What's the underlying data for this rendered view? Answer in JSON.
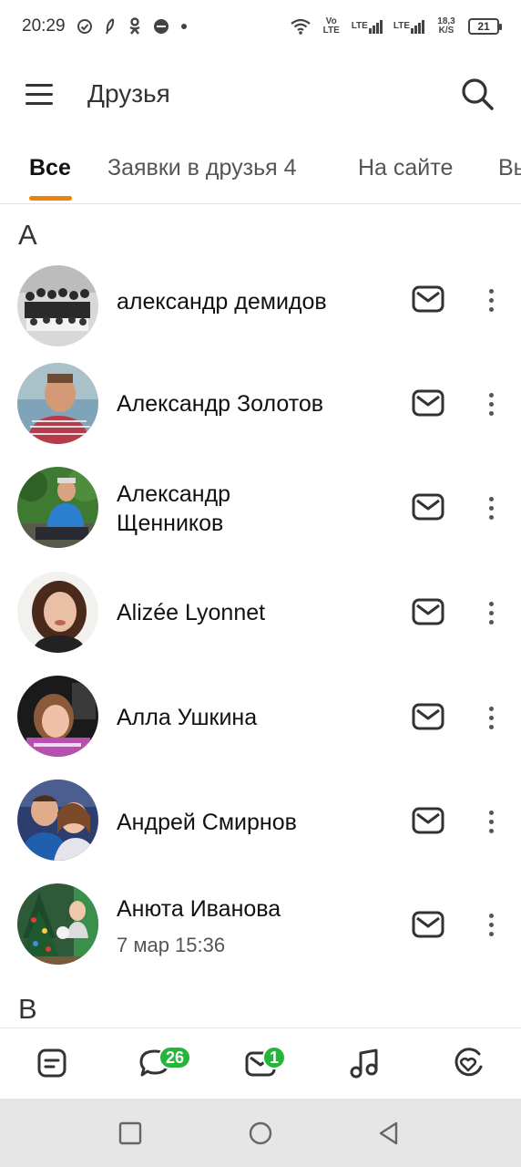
{
  "status_bar": {
    "time": "20:29",
    "volte": "Vo LTE",
    "lte1": "LTE",
    "lte2": "LTE",
    "speed": "18,3 K/S",
    "battery": "21"
  },
  "header": {
    "title": "Друзья"
  },
  "tabs": [
    {
      "label": "Все",
      "active": true
    },
    {
      "label": "Заявки в друзья 4",
      "active": false
    },
    {
      "label": "На сайте",
      "active": false
    },
    {
      "label": "Вы",
      "active": false
    }
  ],
  "sections": [
    {
      "letter": "А"
    },
    {
      "letter": "В"
    }
  ],
  "friends": [
    {
      "name": "александр демидов",
      "sub": ""
    },
    {
      "name": "Александр Золотов",
      "sub": ""
    },
    {
      "name": "Александр Щенников",
      "sub": ""
    },
    {
      "name": "Alizée Lyonnet",
      "sub": ""
    },
    {
      "name": "Алла Ушкина",
      "sub": ""
    },
    {
      "name": "Андрей Смирнов",
      "sub": ""
    },
    {
      "name": "Анюта Иванова",
      "sub": "7 мар 15:36"
    }
  ],
  "bottom_nav": {
    "items": [
      {
        "icon": "feed-icon"
      },
      {
        "icon": "discussions-icon",
        "badge": "26"
      },
      {
        "icon": "messages-icon",
        "badge": "1"
      },
      {
        "icon": "music-icon"
      },
      {
        "icon": "notifications-icon"
      }
    ]
  },
  "colors": {
    "accent": "#ee8208",
    "badge": "#25b53c"
  }
}
